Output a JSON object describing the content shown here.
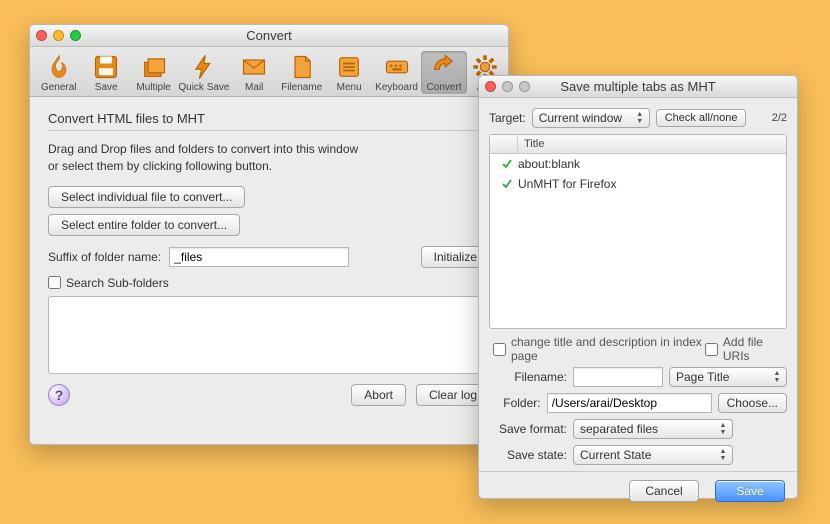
{
  "window1": {
    "title": "Convert",
    "toolbar": [
      {
        "label": "General"
      },
      {
        "label": "Save"
      },
      {
        "label": "Multiple"
      },
      {
        "label": "Quick Save"
      },
      {
        "label": "Mail"
      },
      {
        "label": "Filename"
      },
      {
        "label": "Menu"
      },
      {
        "label": "Keyboard"
      },
      {
        "label": "Convert"
      },
      {
        "label": "Advanced"
      }
    ],
    "section_title": "Convert HTML files to MHT",
    "note_line1": "Drag and Drop files and folders to convert into this window",
    "note_line2": "or select them by clicking following button.",
    "btn_select_file": "Select individual file to convert...",
    "btn_select_folder": "Select entire folder to convert...",
    "suffix_label": "Suffix of folder name:",
    "suffix_value": "_files",
    "btn_initialize": "Initialize",
    "chk_subfolders": "Search Sub-folders",
    "btn_abort": "Abort",
    "btn_clear": "Clear log",
    "help": "?"
  },
  "window2": {
    "title": "Save multiple tabs as MHT",
    "target_label": "Target:",
    "target_value": "Current window",
    "btn_checkall": "Check all/none",
    "count": "2/2",
    "list_header": "Title",
    "items": [
      {
        "title": "about:blank"
      },
      {
        "title": "UnMHT for Firefox"
      }
    ],
    "chk_change_title": "change title and description in index page",
    "chk_add_uris": "Add file URIs",
    "filename_label": "Filename:",
    "filename_value": "",
    "filename_mode": "Page Title",
    "folder_label": "Folder:",
    "folder_value": "/Users/arai/Desktop",
    "btn_choose": "Choose...",
    "format_label": "Save format:",
    "format_value": "separated files",
    "state_label": "Save state:",
    "state_value": "Current State",
    "btn_cancel": "Cancel",
    "btn_save": "Save"
  }
}
